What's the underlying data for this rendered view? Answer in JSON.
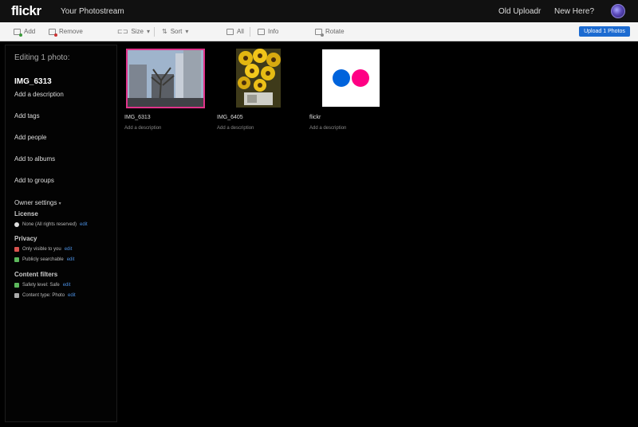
{
  "topbar": {
    "logo": "flickr",
    "photostream": "Your Photostream",
    "old_uploadr": "Old Uploadr",
    "new_here": "New Here?"
  },
  "toolbar": {
    "add": "Add",
    "remove": "Remove",
    "size": "Size",
    "sort": "Sort",
    "all": "All",
    "info": "Info",
    "rotate": "Rotate",
    "upload": "Upload 1 Photos"
  },
  "sidebar": {
    "editing": "Editing 1 photo:",
    "title": "IMG_6313",
    "add_description": "Add a description",
    "add_tags": "Add tags",
    "add_people": "Add people",
    "add_albums": "Add to albums",
    "add_groups": "Add to groups",
    "owner_settings": "Owner settings",
    "license_label": "License",
    "license_value": "None (All rights reserved)",
    "privacy_label": "Privacy",
    "privacy_visible": "Only visible to you",
    "privacy_search": "Publicly searchable",
    "content_label": "Content filters",
    "safety": "Safety level: Safe",
    "content_type": "Content type: Photo",
    "edit": "edit"
  },
  "photos": [
    {
      "name": "IMG_6313",
      "desc": "Add a description"
    },
    {
      "name": "IMG_6405",
      "desc": "Add a description"
    },
    {
      "name": "flickr",
      "desc": "Add a description"
    }
  ],
  "colors": {
    "accent_blue": "#1c6bd1",
    "selected_border": "#e0338a",
    "flickr_blue": "#0063dc",
    "flickr_pink": "#ff0084"
  }
}
